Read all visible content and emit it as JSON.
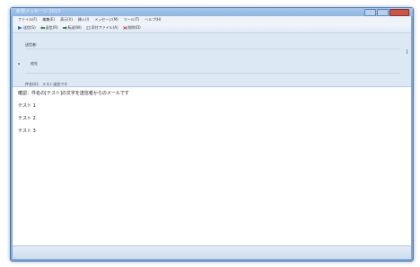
{
  "window": {
    "title": "新規メッセージ 2013",
    "controls": [
      "minimize",
      "maximize",
      "close"
    ]
  },
  "menu": {
    "items": [
      "ファイル(F)",
      "編集(E)",
      "表示(V)",
      "挿入(I)",
      "メッセージ(M)",
      "ツール(T)",
      "ヘルプ(H)"
    ]
  },
  "toolbar": {
    "buttons": [
      {
        "label": "送信(S)",
        "icon": "send-icon"
      },
      {
        "label": "返信(R)",
        "icon": "reply-icon"
      },
      {
        "label": "転送(W)",
        "icon": "forward-icon"
      },
      {
        "label": "添付ファイル(A)",
        "icon": "attach-icon"
      },
      {
        "label": "削除(D)",
        "icon": "delete-icon"
      }
    ]
  },
  "header": {
    "sender_label": "送信者:",
    "to_label": "宛先",
    "subject_label": "件名(U):",
    "subject_value": "テスト送信です"
  },
  "body": {
    "line1": "確認：件名の[テスト]の文字を送信者からのメールです",
    "line2": "テスト 1",
    "line3": "テスト 2",
    "line4": "テスト 3"
  },
  "colors": {
    "frame": "#7fa8d8",
    "header_bg": "#dde8f5",
    "close_button": "#c9584c"
  }
}
